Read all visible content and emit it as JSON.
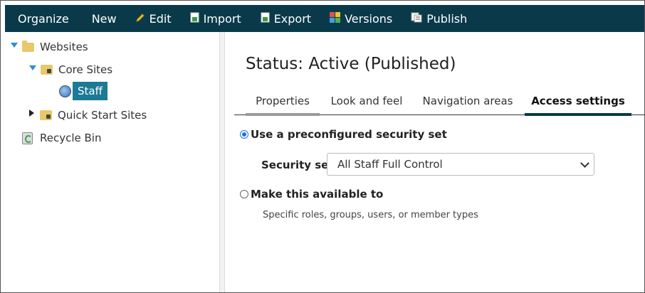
{
  "toolbar": {
    "organize": "Organize",
    "new": "New",
    "edit": "Edit",
    "import": "Import",
    "export": "Export",
    "versions": "Versions",
    "publish": "Publish",
    "icons": {
      "edit": "pencil-icon",
      "import": "import-doc-icon",
      "export": "export-doc-icon",
      "versions": "versions-grid-icon",
      "publish": "publish-icon"
    }
  },
  "tree": {
    "websites": "Websites",
    "core_sites": "Core Sites",
    "staff": "Staff",
    "quick_start_sites": "Quick Start Sites",
    "recycle_bin": "Recycle Bin"
  },
  "main": {
    "status": "Status: Active (Published)",
    "tabs": [
      "Properties",
      "Look and feel",
      "Navigation areas",
      "Access settings"
    ],
    "active_tab": "Access settings",
    "option_preconfigured": "Use a preconfigured security set",
    "security_set_label": "Security set",
    "security_set_value": "All Staff Full Control",
    "option_available_to": "Make this available to",
    "available_to_help": "Specific roles, groups, users, or member types"
  },
  "colors": {
    "toolbar_bg": "#0a3a4a",
    "selected_bg": "#1b7a96",
    "radio_accent": "#1a73e8"
  }
}
